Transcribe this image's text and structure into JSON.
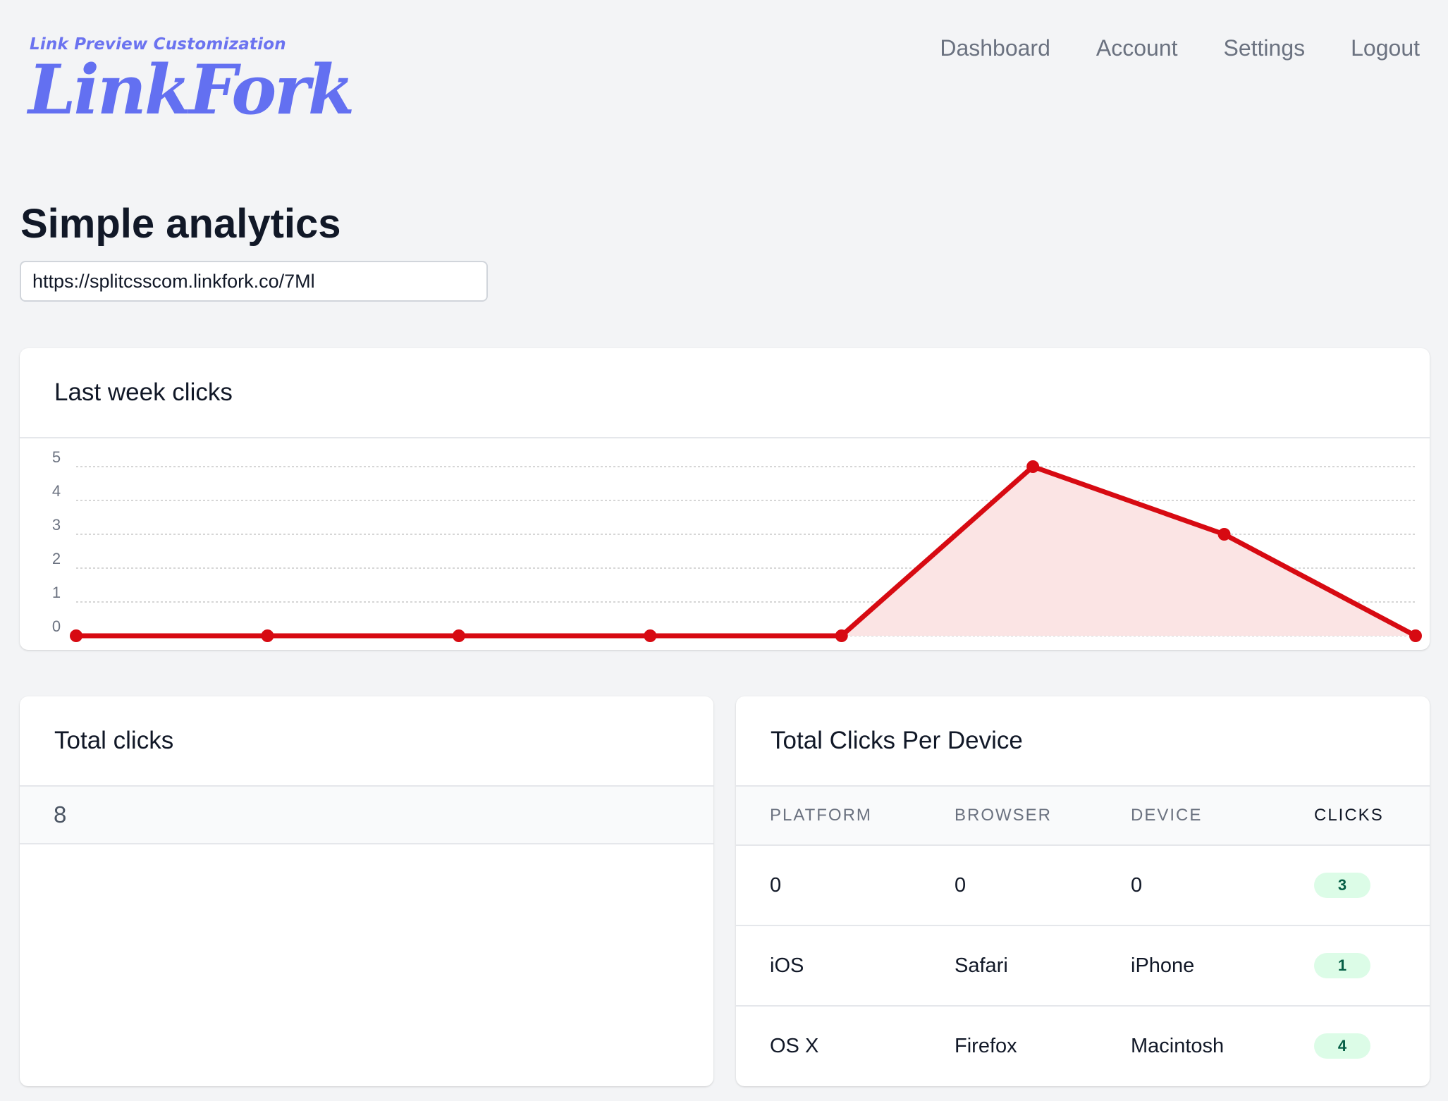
{
  "brand": {
    "tagline": "Link Preview Customization",
    "logo": "LinkFork",
    "color": "#6370f1"
  },
  "nav": {
    "items": [
      {
        "label": "Dashboard"
      },
      {
        "label": "Account"
      },
      {
        "label": "Settings"
      },
      {
        "label": "Logout"
      }
    ]
  },
  "page": {
    "title": "Simple analytics",
    "url_value": "https://splitcsscom.linkfork.co/7Ml"
  },
  "weekly_card": {
    "title": "Last week clicks"
  },
  "chart_data": {
    "type": "area",
    "x": [
      1,
      2,
      3,
      4,
      5,
      6,
      7,
      8
    ],
    "values": [
      0,
      0,
      0,
      0,
      0,
      5,
      3,
      0
    ],
    "yticks": [
      0,
      1,
      2,
      3,
      4,
      5
    ],
    "ylim": [
      0,
      5
    ],
    "grid": true,
    "line_color": "#d70a12",
    "fill_color": "#fbe4e4"
  },
  "total_card": {
    "title": "Total clicks",
    "value": "8"
  },
  "device_card": {
    "title": "Total Clicks Per Device",
    "columns": [
      "PLATFORM",
      "BROWSER",
      "DEVICE",
      "CLICKS"
    ],
    "rows": [
      {
        "platform": "0",
        "browser": "0",
        "device": "0",
        "clicks": "3"
      },
      {
        "platform": "iOS",
        "browser": "Safari",
        "device": "iPhone",
        "clicks": "1"
      },
      {
        "platform": "OS X",
        "browser": "Firefox",
        "device": "Macintosh",
        "clicks": "4"
      }
    ],
    "badge_color": "#dcfce7"
  }
}
